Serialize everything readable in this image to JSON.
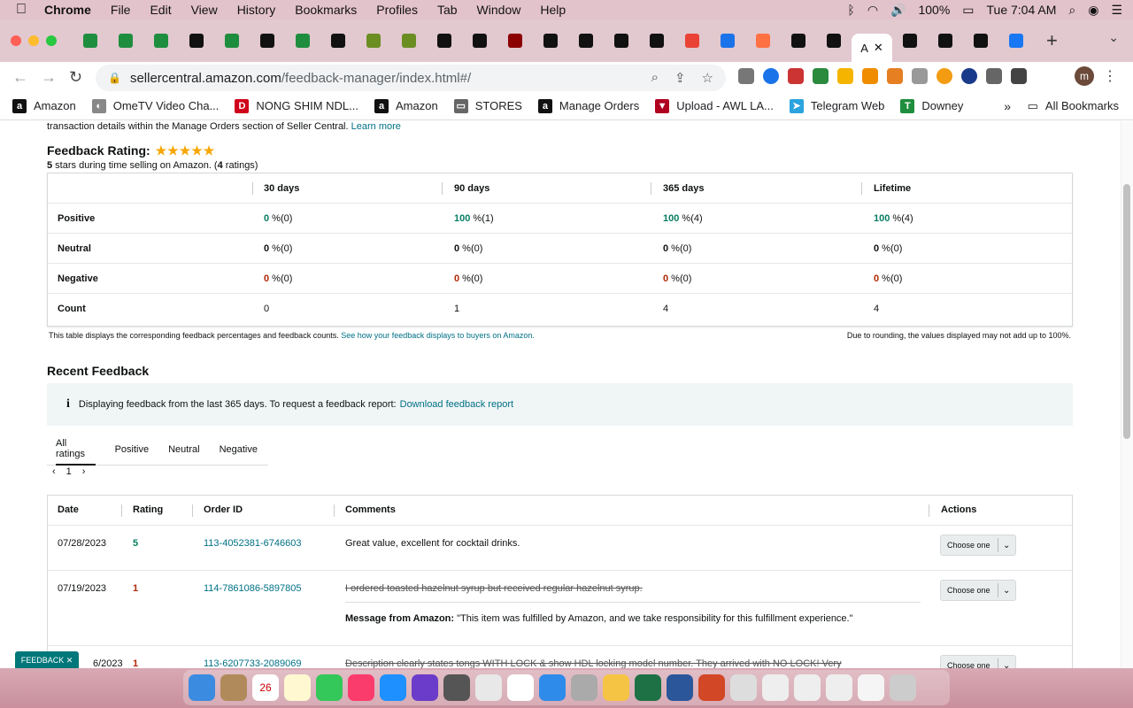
{
  "menubar": {
    "app": "Chrome",
    "items": [
      "File",
      "Edit",
      "View",
      "History",
      "Bookmarks",
      "Profiles",
      "Tab",
      "Window",
      "Help"
    ],
    "battery": "100%",
    "clock": "Tue 7:04 AM"
  },
  "tabs": {
    "favicons": [
      "green",
      "green",
      "green-n",
      "amazon",
      "green-n",
      "amazon",
      "green-n",
      "amazon",
      "leaf",
      "leaf",
      "amazon",
      "amazon",
      "ww",
      "amazon",
      "amazon",
      "amazon",
      "amazon",
      "gmail",
      "18",
      "pencil",
      "amazon",
      "amazon",
      "active",
      "amazon",
      "amazon",
      "amazon",
      "facebook"
    ],
    "active_label": "A",
    "new_tab": "+"
  },
  "address": {
    "host": "sellercentral.amazon.com",
    "path": "/feedback-manager/index.html#/",
    "profile_initial": "m"
  },
  "bookmarks": {
    "items": [
      {
        "label": "Amazon",
        "color": "#111111",
        "glyph": "a"
      },
      {
        "label": "OmeTV Video Cha...",
        "color": "#888888",
        "glyph": "◐"
      },
      {
        "label": "NONG SHIM NDL...",
        "color": "#d0021b",
        "glyph": "D"
      },
      {
        "label": "Amazon",
        "color": "#111111",
        "glyph": "a"
      },
      {
        "label": "STORES",
        "color": "#666666",
        "glyph": "▭"
      },
      {
        "label": "Manage Orders",
        "color": "#111111",
        "glyph": "a"
      },
      {
        "label": "Upload - AWL LA...",
        "color": "#b00020",
        "glyph": "▼"
      },
      {
        "label": "Telegram Web",
        "color": "#2aa3de",
        "glyph": "➤"
      },
      {
        "label": "Downey",
        "color": "#1e8e3e",
        "glyph": "T"
      }
    ],
    "more": "»",
    "all": "All Bookmarks"
  },
  "page": {
    "intro_text": "transaction details within the Manage Orders section of Seller Central.",
    "intro_link": "Learn more",
    "rating_title": "Feedback Rating:",
    "stars": "★★★★★",
    "rating_sub_a": "5",
    "rating_sub_b": " stars during time selling on Amazon. (",
    "rating_sub_c": "4",
    "rating_sub_d": " ratings)",
    "feedback_table": {
      "headers": [
        "30 days",
        "90 days",
        "365 days",
        "Lifetime"
      ],
      "rows": [
        {
          "label": "Positive",
          "cells": [
            {
              "v": "0",
              "s": " %(0)",
              "c": "g"
            },
            {
              "v": "100",
              "s": " %(1)",
              "c": "g"
            },
            {
              "v": "100",
              "s": " %(4)",
              "c": "g"
            },
            {
              "v": "100",
              "s": " %(4)",
              "c": "g"
            }
          ]
        },
        {
          "label": "Neutral",
          "cells": [
            {
              "v": "0",
              "s": " %(0)",
              "c": "b"
            },
            {
              "v": "0",
              "s": " %(0)",
              "c": "b"
            },
            {
              "v": "0",
              "s": " %(0)",
              "c": "b"
            },
            {
              "v": "0",
              "s": " %(0)",
              "c": "b"
            }
          ]
        },
        {
          "label": "Negative",
          "cells": [
            {
              "v": "0",
              "s": " %(0)",
              "c": "r"
            },
            {
              "v": "0",
              "s": " %(0)",
              "c": "r"
            },
            {
              "v": "0",
              "s": " %(0)",
              "c": "r"
            },
            {
              "v": "0",
              "s": " %(0)",
              "c": "r"
            }
          ]
        },
        {
          "label": "Count",
          "cells": [
            {
              "v": "",
              "s": "0",
              "c": ""
            },
            {
              "v": "",
              "s": "1",
              "c": ""
            },
            {
              "v": "",
              "s": "4",
              "c": ""
            },
            {
              "v": "",
              "s": "4",
              "c": ""
            }
          ]
        }
      ]
    },
    "note_left": "This table displays the corresponding feedback percentages and feedback counts.",
    "note_link": "See how your feedback displays to buyers on Amazon.",
    "note_right": "Due to rounding, the values displayed may not add up to 100%.",
    "recent_title": "Recent Feedback",
    "info_text": "Displaying feedback from the last 365 days. To request a feedback report:",
    "info_link": "Download feedback report",
    "filter_tabs": [
      "All ratings",
      "Positive",
      "Neutral",
      "Negative"
    ],
    "page_number": "1",
    "recent_table": {
      "headers": [
        "Date",
        "Rating",
        "Order ID",
        "Comments",
        "Actions"
      ],
      "rows": [
        {
          "date": "07/28/2023",
          "rating": "5",
          "order": "113-4052381-6746603",
          "comment": "Great value, excellent for cocktail drinks.",
          "action": "Choose one"
        },
        {
          "date": "07/19/2023",
          "rating": "1",
          "order": "114-7861086-5897805",
          "comment": "I ordered toasted hazelnut syrup but received regular hazelnut syrup.",
          "msg_label": "Message from Amazon:",
          "msg": " \"This item was fulfilled by Amazon, and we take responsibility for this fulfillment experience.\"",
          "action": "Choose one"
        },
        {
          "date": "6/2023",
          "rating": "1",
          "order": "113-6207733-2089069",
          "comment": "Description clearly states tongs WITH LOCK & show HDL locking model number. They arrived with NO LOCK! Very",
          "action": "Choose one"
        }
      ]
    },
    "feedback_button": "FEEDBACK ✕"
  },
  "dock": {
    "calendar_day": "26",
    "calendar_month": "SEP"
  },
  "colors": {
    "link": "#007185",
    "positive": "#067d62",
    "negative": "#b12704"
  }
}
